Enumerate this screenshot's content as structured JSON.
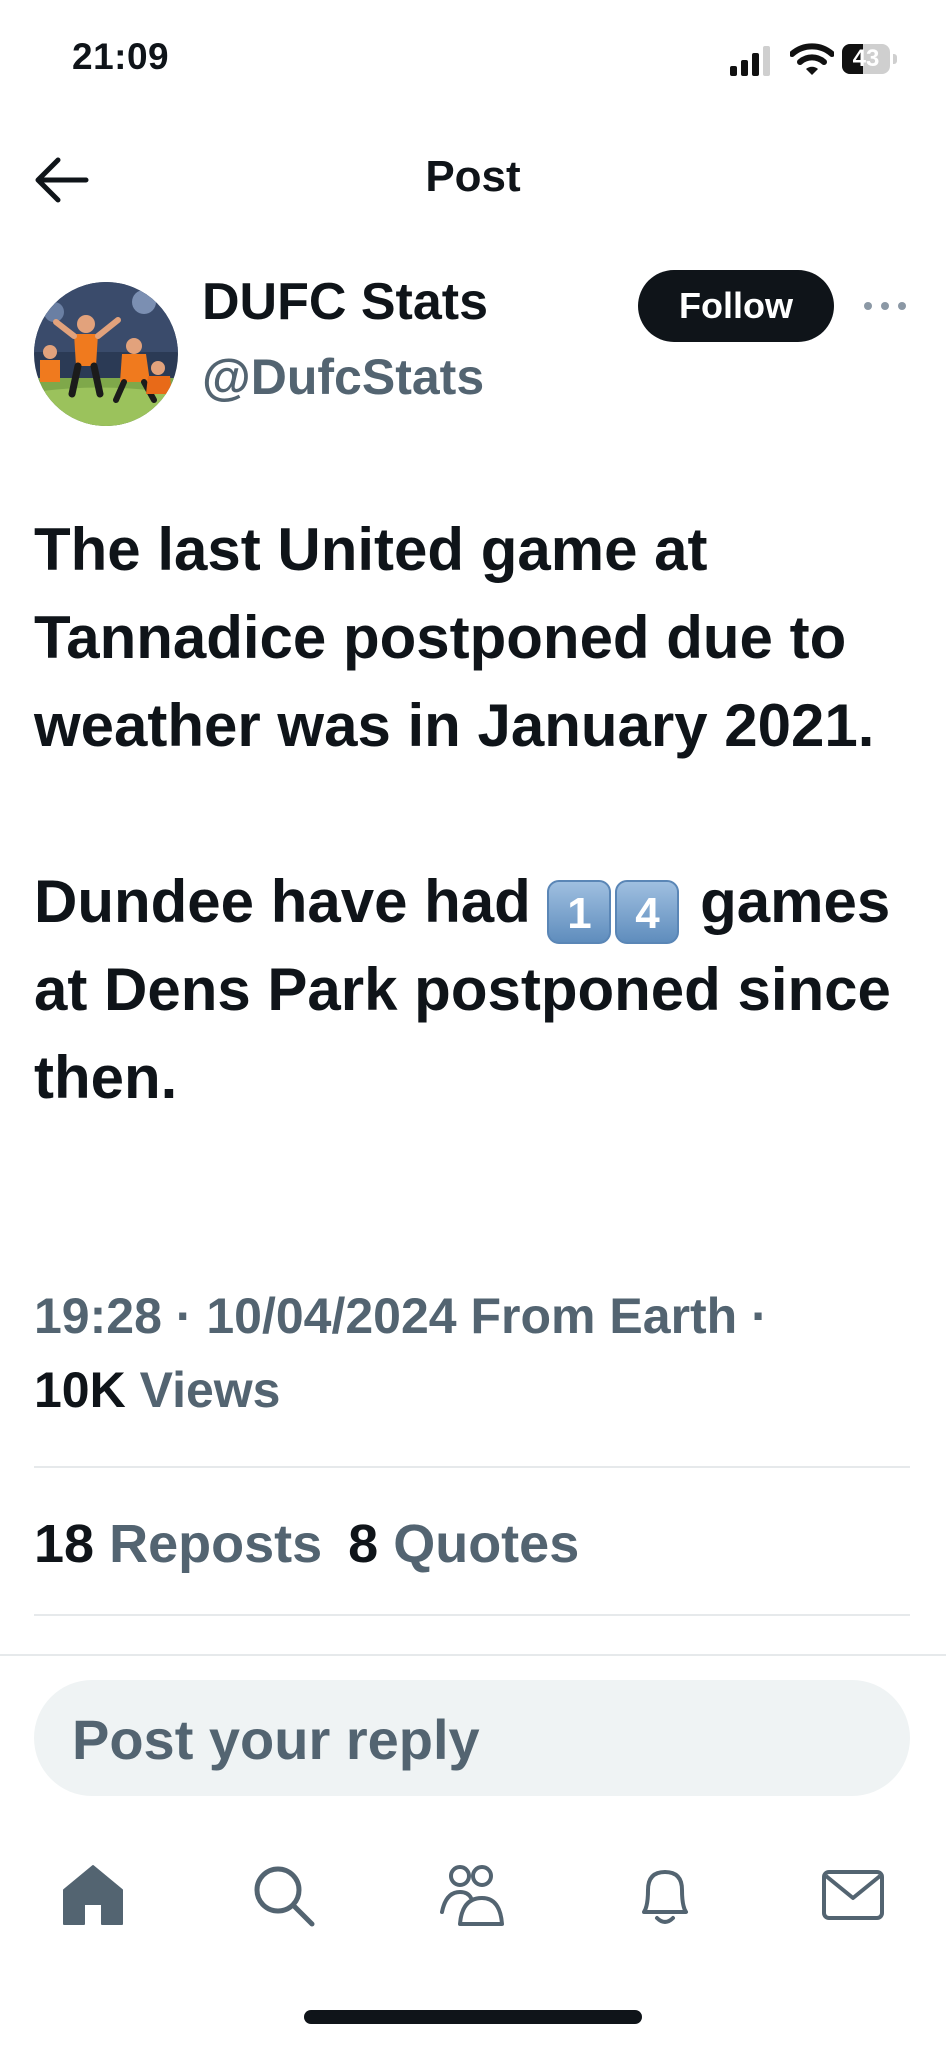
{
  "status_bar": {
    "time": "21:09",
    "battery": "43",
    "battery_level": 0.43,
    "icons": [
      "signal-icon",
      "wifi-icon",
      "battery-icon"
    ]
  },
  "header": {
    "title": "Post",
    "back_icon": "arrow-left-icon"
  },
  "author": {
    "display_name": "DUFC Stats",
    "handle": "@DufcStats",
    "follow_label": "Follow",
    "more_icon": "more-horizontal-icon"
  },
  "post": {
    "paragraph1": "The last United game at Tannadice postponed due to weather was in January 2021.",
    "paragraph2_before": "Dundee have had",
    "keycap_digits": [
      "1",
      "4"
    ],
    "paragraph2_after": "games at Dens Park postponed since then."
  },
  "meta": {
    "time": "19:28",
    "separator": "·",
    "date": "10/04/2024",
    "source": "From Earth",
    "views_count": "10K",
    "views_label": "Views"
  },
  "stats": {
    "reposts_count": "18",
    "reposts_label": "Reposts",
    "quotes_count": "8",
    "quotes_label": "Quotes"
  },
  "reply": {
    "placeholder": "Post your reply"
  },
  "bottom_nav": {
    "items": [
      "home-icon",
      "search-icon",
      "communities-icon",
      "notifications-icon",
      "messages-icon"
    ]
  },
  "colors": {
    "text_primary": "#0f1419",
    "text_secondary": "#536471",
    "follow_button_bg": "#0f1419",
    "reply_box_bg": "#eff3f4",
    "divider": "#e6e9eb"
  }
}
